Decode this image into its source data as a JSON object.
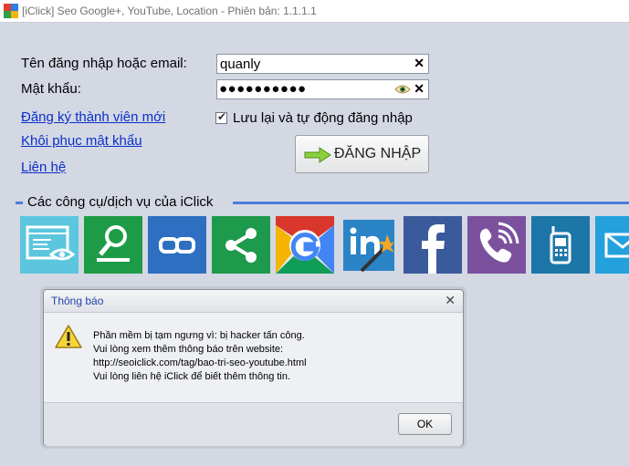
{
  "window": {
    "title": "[iClick] Seo Google+, YouTube, Location - Phiên bản: 1.1.1.1"
  },
  "login": {
    "username_label": "Tên đăng nhập hoặc email:",
    "username_value": "quanly",
    "password_label": "Mật khẩu:",
    "password_value": "●●●●●●●●●●",
    "clear_symbol": "✕",
    "register_link": "Đăng ký thành viên mới",
    "recover_link": "Khôi phục mật khẩu",
    "contact_link": "Liên hệ",
    "remember_label": "Lưu lại và tự động đăng nhập",
    "remember_checked": true,
    "remember_check_mark": "✔",
    "login_button": "ĐĂNG NHẬP"
  },
  "tools": {
    "section_title": "Các công cụ/dịch vụ của iClick",
    "tiles": [
      {
        "icon": "browser-eye-icon",
        "color": "#5bc6dd"
      },
      {
        "icon": "search-person-icon",
        "color": "#1e9b46"
      },
      {
        "icon": "link-icon",
        "color": "#2f6fc1"
      },
      {
        "icon": "share-icon",
        "color": "#1d9a4b"
      },
      {
        "icon": "google-icon",
        "color": "#e9e9e9"
      },
      {
        "icon": "linkedin-wand-icon",
        "color": "#2a84c6"
      },
      {
        "icon": "facebook-icon",
        "color": "#3b5a9b"
      },
      {
        "icon": "viber-icon",
        "color": "#7b519d"
      },
      {
        "icon": "phone-icon",
        "color": "#1d76a8"
      },
      {
        "icon": "email-icon",
        "color": "#22a1dc"
      }
    ]
  },
  "dialog": {
    "title": "Thông báo",
    "close_symbol": "✕",
    "lines": [
      "Phần mềm bị tạm ngưng vì: bị hacker tấn công.",
      "Vui lòng xem thêm thông báo trên website:",
      "http://seoiclick.com/tag/bao-tri-seo-youtube.html",
      "Vui lòng liên hệ iClick để biết thêm thông tin."
    ],
    "ok_button": "OK"
  }
}
